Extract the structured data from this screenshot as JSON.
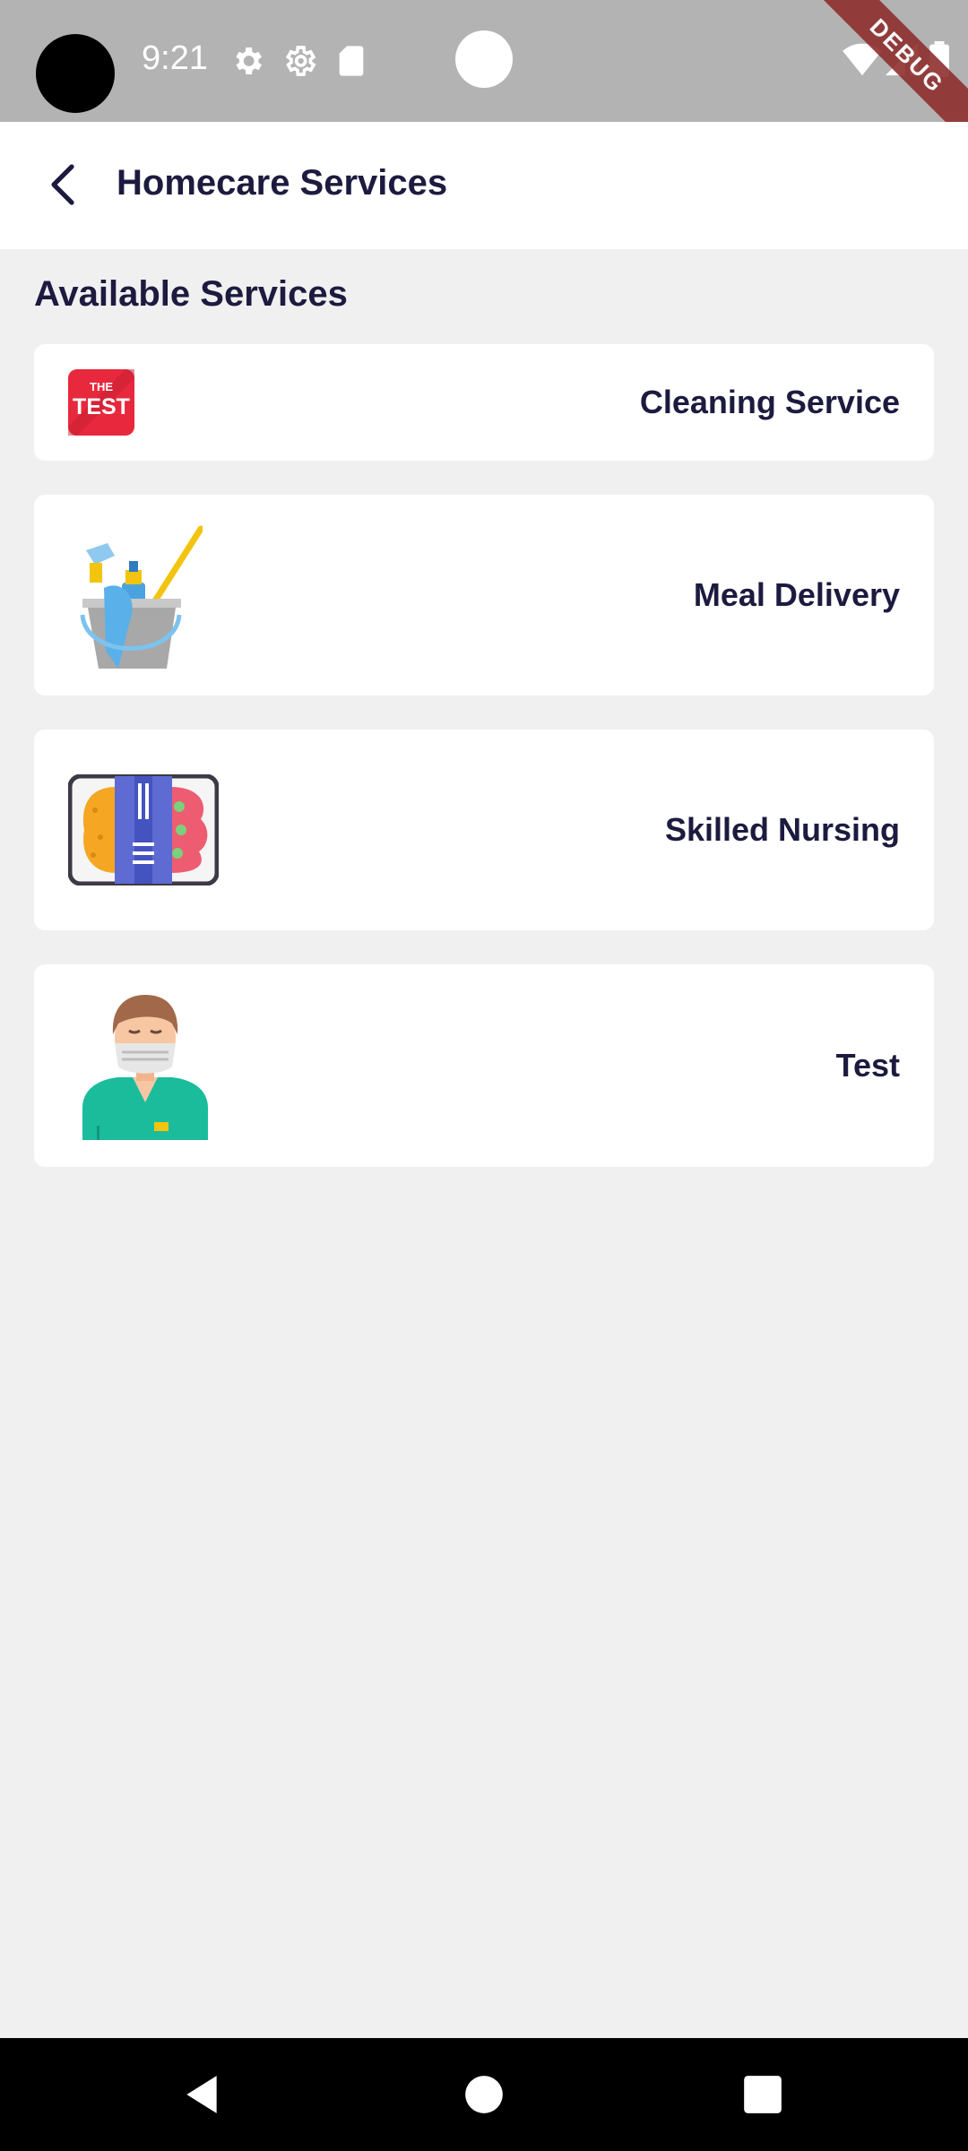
{
  "status_bar": {
    "time": "9:21",
    "icons": [
      "settings-icon",
      "settings-outline-icon",
      "sd-card-icon",
      "wifi-icon",
      "signal-icon",
      "battery-icon"
    ]
  },
  "debug_banner": "DEBUG",
  "app_bar": {
    "back_icon": "chevron-left-icon",
    "title": "Homecare Services"
  },
  "section_title": "Available Services",
  "services": [
    {
      "label": "Cleaning Service",
      "icon": "the-test-logo"
    },
    {
      "label": "Meal Delivery",
      "icon": "cleaning-bucket-icon"
    },
    {
      "label": "Skilled Nursing",
      "icon": "meal-tray-icon"
    },
    {
      "label": "Test",
      "icon": "nurse-icon"
    }
  ],
  "logo_text": {
    "top": "THE",
    "bottom": "TEST"
  },
  "nav_bar": {
    "icons": [
      "back-triangle-icon",
      "home-circle-icon",
      "recents-square-icon"
    ]
  },
  "colors": {
    "status_bar": "#b3b3b3",
    "background": "#f0f0f0",
    "card": "#ffffff",
    "text": "#1c1b3f",
    "debug": "#8e2f2f"
  }
}
